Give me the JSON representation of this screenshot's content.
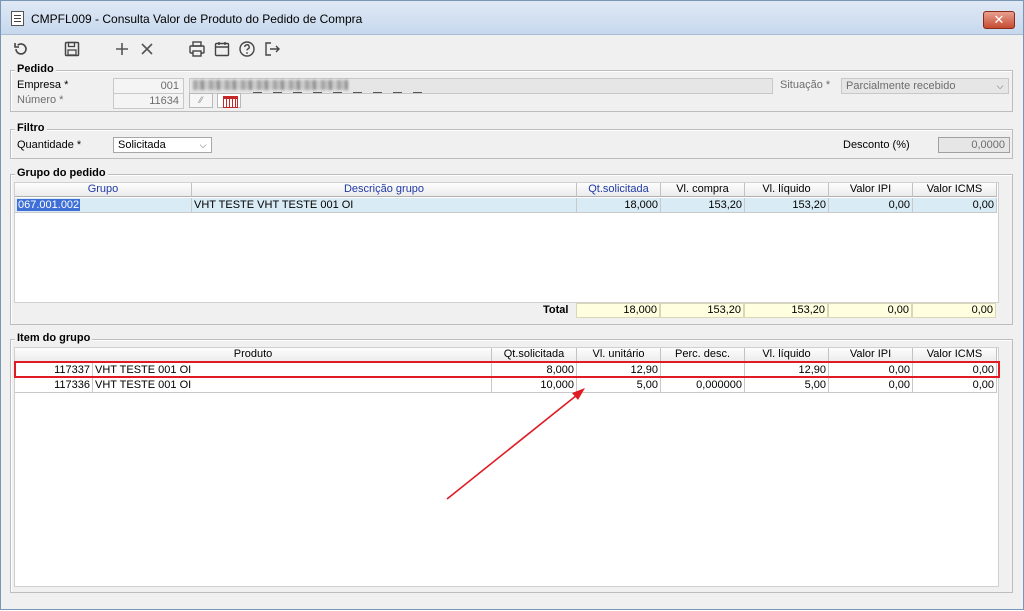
{
  "window": {
    "title": "CMPFL009 - Consulta Valor de Produto do Pedido de Compra",
    "close_label": "✕"
  },
  "toolbar": {
    "icons": [
      "refresh-icon",
      "save-icon",
      "add-icon",
      "cancel-icon",
      "print-icon",
      "calendar-icon",
      "help-icon",
      "exit-icon"
    ]
  },
  "pedido": {
    "legend": "Pedido",
    "empresa_label": "Empresa *",
    "empresa_value": "001",
    "numero_label": "Número *",
    "numero_value": "11634",
    "situacao_label": "Situação *",
    "situacao_value": "Parcialmente recebido"
  },
  "filtro": {
    "legend": "Filtro",
    "quantidade_label": "Quantidade *",
    "quantidade_value": "Solicitada",
    "desconto_label": "Desconto (%)",
    "desconto_value": "0,0000"
  },
  "grupo": {
    "legend": "Grupo do pedido",
    "headers": [
      "Grupo",
      "Descrição grupo",
      "Qt.solicitada",
      "Vl. compra",
      "Vl. líquido",
      "Valor IPI",
      "Valor ICMS"
    ],
    "rows": [
      [
        "067.001.002",
        "VHT TESTE VHT TESTE 001 OI",
        "18,000",
        "153,20",
        "153,20",
        "0,00",
        "0,00"
      ]
    ],
    "total_label": "Total",
    "totals": [
      "18,000",
      "153,20",
      "153,20",
      "0,00",
      "0,00"
    ]
  },
  "item": {
    "legend": "Item do grupo",
    "headers": [
      "Produto",
      "Qt.solicitada",
      "Vl. unitário",
      "Perc. desc.",
      "Vl. líquido",
      "Valor IPI",
      "Valor ICMS"
    ],
    "rows": [
      [
        "117337",
        "VHT TESTE 001 OI",
        "8,000",
        "12,90",
        "",
        "12,90",
        "0,00",
        "0,00"
      ],
      [
        "117336",
        "VHT TESTE 001 OI",
        "10,000",
        "5,00",
        "0,000000",
        "5,00",
        "0,00",
        "0,00"
      ]
    ]
  },
  "colors": {
    "highlight": "#e01b24",
    "header_blue": "#1f3aa5",
    "total_bg": "#ffffe0",
    "selection": "#3d6fd6"
  }
}
